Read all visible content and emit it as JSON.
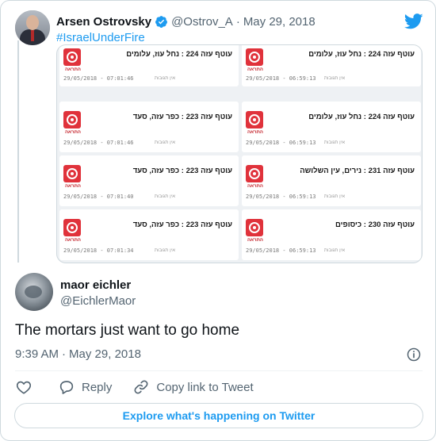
{
  "colors": {
    "accent": "#1d9bf0",
    "text": "#0f1419",
    "muted": "#536471",
    "border": "#cfd9de",
    "alert_red": "#e0323b"
  },
  "quoted_tweet": {
    "author_name": "Arsen Ostrovsky",
    "verified": true,
    "handle": "@Ostrov_A",
    "separator": "·",
    "date": "May 29, 2018",
    "hashtag": "#IsraelUnderFire",
    "media": {
      "logo_caption": "התראה",
      "note": "אין תגובות",
      "tiles": [
        {
          "text": "עוטף עזה 224 : נחל עוז, עלומים",
          "timestamp": "29/05/2018 - 07:01:46"
        },
        {
          "text": "עוטף עזה 224 : נחל עוז, עלומים",
          "timestamp": "29/05/2018 - 06:59:13"
        },
        {
          "text": "עוטף עזה 223 : כפר עזה, סעד",
          "timestamp": "29/05/2018 - 07:01:46"
        },
        {
          "text": "עוטף עזה 224 : נחל עוז, עלומים",
          "timestamp": "29/05/2018 - 06:59:13"
        },
        {
          "text": "עוטף עזה 223 : כפר עזה, סעד",
          "timestamp": "29/05/2018 - 07:01:40"
        },
        {
          "text": "עוטף עזה 231 : נירים, עין השלושה",
          "timestamp": "29/05/2018 - 06:59:13"
        },
        {
          "text": "עוטף עזה 223 : כפר עזה, סעד",
          "timestamp": "29/05/2018 - 07:01:34"
        },
        {
          "text": "עוטף עזה 230 : כיסופים",
          "timestamp": "29/05/2018 - 06:59:13"
        }
      ]
    }
  },
  "tweet": {
    "author_name": "maor eichler",
    "handle": "@EichlerMaor",
    "text": "The mortars just want to go home",
    "time": "9:39 AM",
    "separator": "·",
    "date": "May 29, 2018",
    "icons": {
      "info": "info-icon",
      "like": "heart-icon",
      "reply": "speech-bubble-icon",
      "copy_link": "link-icon",
      "platform": "twitter-bird-icon"
    }
  },
  "actions": {
    "reply_label": "Reply",
    "copy_link_label": "Copy link to Tweet"
  },
  "footer": {
    "explore_label": "Explore what's happening on Twitter"
  }
}
